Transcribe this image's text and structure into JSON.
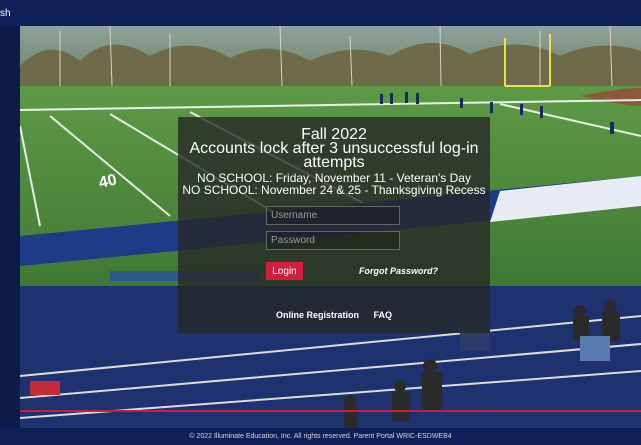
{
  "topbar": {
    "language_label": "sh"
  },
  "notice": {
    "title": "Fall 2022",
    "line2": "Accounts lock after 3 unsuccessful log-in attempts",
    "line3": "NO SCHOOL:  Friday, November 11 - Veteran's Day",
    "line4": "NO SCHOOL:  November 24 & 25 - Thanksgiving Recess"
  },
  "form": {
    "username_placeholder": "Username",
    "password_placeholder": "Password",
    "login_label": "Login",
    "forgot_label": "Forgot Password?"
  },
  "links": {
    "online_registration": "Online Registration",
    "faq": "FAQ"
  },
  "footer": {
    "text": "© 2022 Illuminate Education, Inc. All rights reserved. Parent Portal WRIC-ESDWEB4"
  },
  "colors": {
    "brand_navy": "#0f1f57",
    "accent_red": "#d11f3d"
  }
}
